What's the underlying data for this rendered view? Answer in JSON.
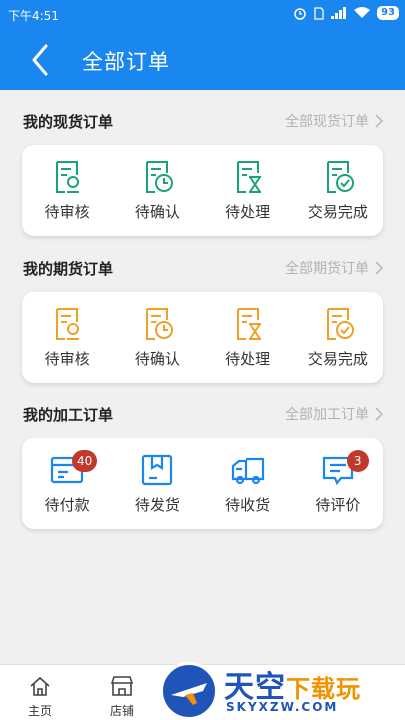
{
  "status_bar": {
    "time": "下午4:51",
    "battery": "93"
  },
  "header": {
    "title": "全部订单"
  },
  "sections": [
    {
      "title": "我的现货订单",
      "more": "全部现货订单",
      "color": "#1aa37a",
      "items": [
        {
          "label": "待审核",
          "icon": "review-icon"
        },
        {
          "label": "待确认",
          "icon": "clock-icon"
        },
        {
          "label": "待处理",
          "icon": "hourglass-icon"
        },
        {
          "label": "交易完成",
          "icon": "check-icon"
        }
      ]
    },
    {
      "title": "我的期货订单",
      "more": "全部期货订单",
      "color": "#f0a025",
      "items": [
        {
          "label": "待审核",
          "icon": "review-icon"
        },
        {
          "label": "待确认",
          "icon": "clock-icon"
        },
        {
          "label": "待处理",
          "icon": "hourglass-icon"
        },
        {
          "label": "交易完成",
          "icon": "check-icon"
        }
      ]
    },
    {
      "title": "我的加工订单",
      "more": "全部加工订单",
      "color": "#1a86f0",
      "items": [
        {
          "label": "待付款",
          "icon": "wallet-icon",
          "badge": "40"
        },
        {
          "label": "待发货",
          "icon": "package-icon"
        },
        {
          "label": "待收货",
          "icon": "truck-icon"
        },
        {
          "label": "待评价",
          "icon": "comment-icon",
          "badge": "3"
        }
      ]
    }
  ],
  "tabbar": [
    {
      "label": "主页",
      "icon": "home-icon"
    },
    {
      "label": "店铺",
      "icon": "store-icon"
    }
  ],
  "watermark": {
    "brand_a": "天空",
    "brand_b": "下载玩",
    "site": "SKYXZW.COM"
  },
  "colors": {
    "primary": "#1a86f0",
    "badge": "#c0392b"
  }
}
